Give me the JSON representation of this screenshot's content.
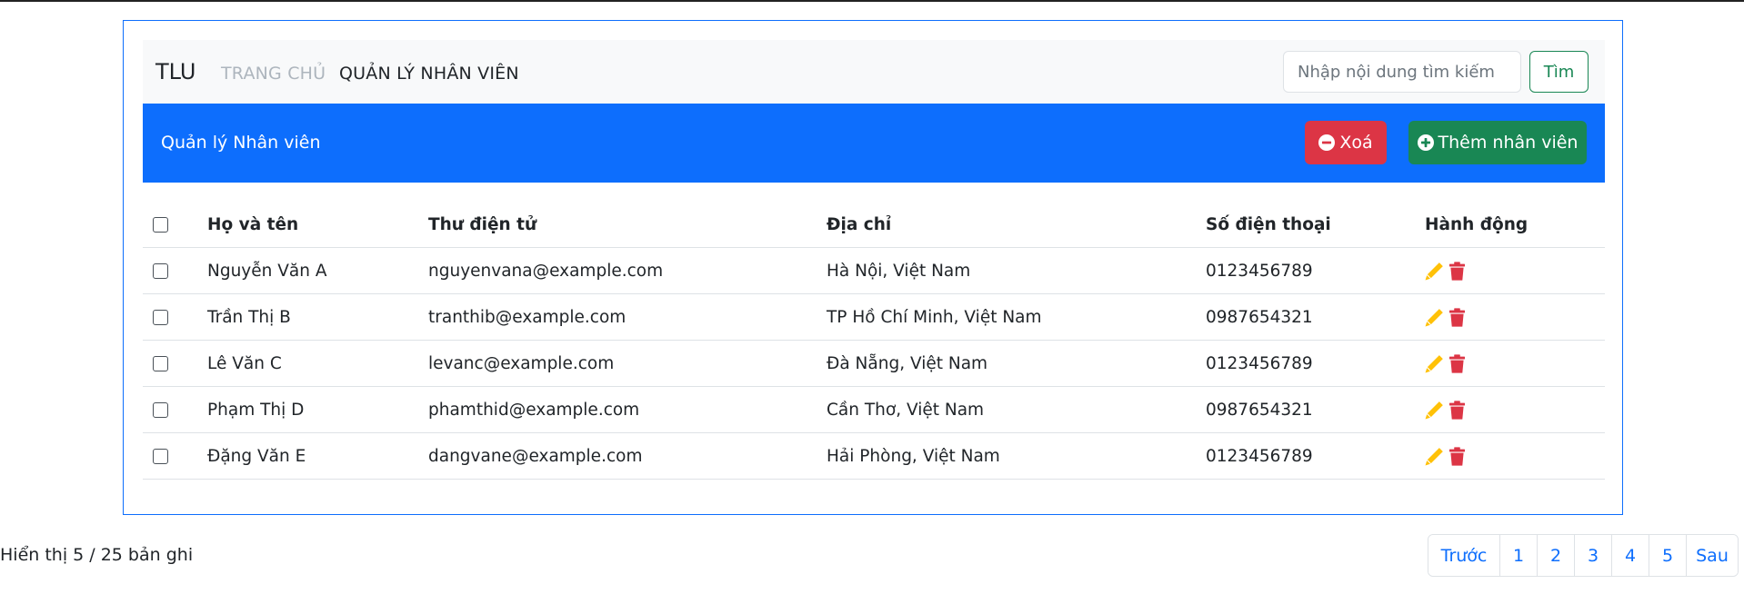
{
  "navbar": {
    "brand": "TLU",
    "links": [
      {
        "label": "TRANG CHỦ",
        "active": false
      },
      {
        "label": "QUẢN LÝ NHÂN VIÊN",
        "active": true
      }
    ],
    "search": {
      "placeholder": "Nhập nội dung tìm kiếm",
      "value": "",
      "button_label": "Tìm"
    }
  },
  "header": {
    "title": "Quản lý Nhân viên",
    "delete_label": "Xoá",
    "add_label": "Thêm nhân viên"
  },
  "table": {
    "columns": [
      "Họ và tên",
      "Thư điện tử",
      "Địa chỉ",
      "Số điện thoại",
      "Hành động"
    ],
    "rows": [
      {
        "name": "Nguyễn Văn A",
        "email": "nguyenvana@example.com",
        "address": "Hà Nội, Việt Nam",
        "phone": "0123456789"
      },
      {
        "name": "Trần Thị B",
        "email": "tranthib@example.com",
        "address": "TP Hồ Chí Minh, Việt Nam",
        "phone": "0987654321"
      },
      {
        "name": "Lê Văn C",
        "email": "levanc@example.com",
        "address": "Đà Nẵng, Việt Nam",
        "phone": "0123456789"
      },
      {
        "name": "Phạm Thị D",
        "email": "phamthid@example.com",
        "address": "Cần Thơ, Việt Nam",
        "phone": "0987654321"
      },
      {
        "name": "Đặng Văn E",
        "email": "dangvane@example.com",
        "address": "Hải Phòng, Việt Nam",
        "phone": "0123456789"
      }
    ],
    "row_actions": [
      "pencil-icon",
      "trash-icon"
    ]
  },
  "footer": {
    "info": "Hiển thị 5 / 25 bản ghi",
    "pagination": {
      "prev": "Trước",
      "pages": [
        "1",
        "2",
        "3",
        "4",
        "5"
      ],
      "next": "Sau"
    }
  },
  "colors": {
    "primary": "#0d6efd",
    "danger": "#dc3545",
    "success": "#198754",
    "edit_icon": "#ffc107",
    "nav_muted": "#adb5bd"
  }
}
